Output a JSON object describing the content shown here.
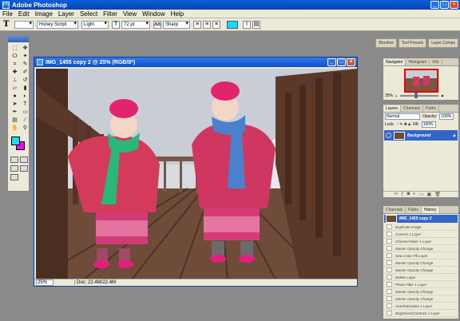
{
  "app": {
    "title": "Adobe Photoshop",
    "icon": "photoshop-app-icon"
  },
  "menu": [
    "File",
    "Edit",
    "Image",
    "Layer",
    "Select",
    "Filter",
    "View",
    "Window",
    "Help"
  ],
  "options": {
    "tool_glyph": "T",
    "font_family": "Honey Script",
    "font_style": "Light",
    "size_icon": "font-size-icon",
    "font_size": "72 pt",
    "aa_label": "aa",
    "antialias": "Sharp",
    "color": "#00e0ff"
  },
  "palette_well": [
    "Brushes",
    "Tool Presets",
    "Layer Comps"
  ],
  "document": {
    "title": "IMG_1455 copy 2 @ 25% (RGB/8*)",
    "zoom": "25%",
    "doc_size": "Doc: 22.4M/22.4M"
  },
  "navigator": {
    "tabs": [
      "Navigator",
      "Histogram",
      "Info"
    ],
    "zoom": "25%"
  },
  "layers": {
    "tabs": [
      "Layers",
      "Channels",
      "Paths"
    ],
    "blend_mode": "Normal",
    "opacity_label": "Opacity:",
    "opacity": "100%",
    "lock_label": "Lock:",
    "fill_label": "Fill:",
    "fill": "100%",
    "layer_name": "Background"
  },
  "history": {
    "tabs": [
      "Channels",
      "Paths",
      "History"
    ],
    "source": "IMG_1455 copy 2",
    "items": [
      "Duplicate Image",
      "Convert 1 Layer",
      "Channel Mixer 1 Layer",
      "Master Opacity Change",
      "New Color Fill Layer",
      "Master Opacity Change",
      "Master Opacity Change",
      "Delete Layer",
      "Photo Filter 1 Layer",
      "Master Opacity Change",
      "Master Opacity Change",
      "Hue/Saturation 1 Layer",
      "Brightness/Contrast 1 Layer"
    ]
  },
  "colors": {
    "foreground": "#00e5ff",
    "background": "#ff00ff"
  }
}
